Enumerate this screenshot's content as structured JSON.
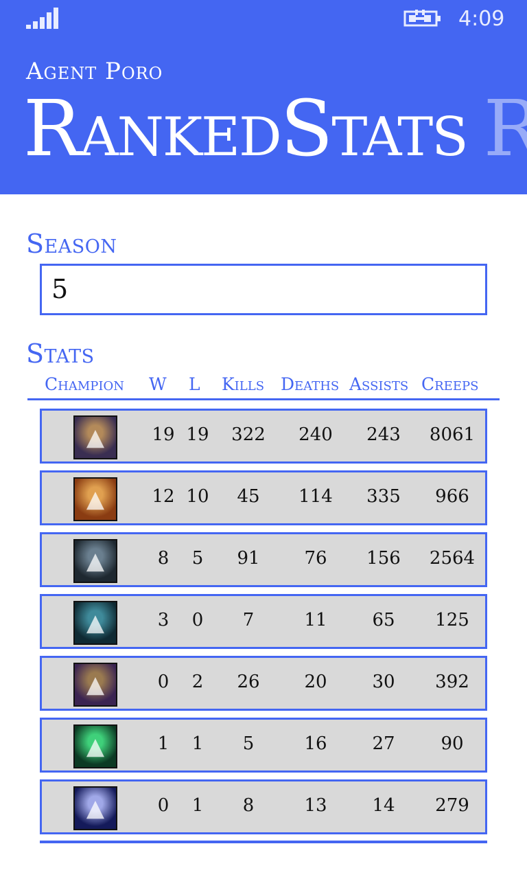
{
  "status_bar": {
    "time": "4:09",
    "signal_icon": "signal-bars-icon",
    "battery_icon": "battery-charging-icon"
  },
  "header": {
    "app_name": "Agent Poro",
    "title": "RankedStats",
    "next_pivot": "R",
    "background_color": "#4466f2"
  },
  "season": {
    "label": "Season",
    "value": "5"
  },
  "stats": {
    "label": "Stats",
    "columns": [
      "Champion",
      "W",
      "L",
      "Kills",
      "Deaths",
      "Assists",
      "Creeps"
    ],
    "rows": [
      {
        "champion_icon": "champion-portrait-1-icon",
        "colors": [
          "#3a2e52",
          "#b38a5a"
        ],
        "w": "19",
        "l": "19",
        "kills": "322",
        "deaths": "240",
        "assists": "243",
        "creeps": "8061"
      },
      {
        "champion_icon": "champion-portrait-2-icon",
        "colors": [
          "#8a3c12",
          "#e0a050"
        ],
        "w": "12",
        "l": "10",
        "kills": "45",
        "deaths": "114",
        "assists": "335",
        "creeps": "966"
      },
      {
        "champion_icon": "champion-portrait-3-icon",
        "colors": [
          "#1e2830",
          "#6a7f8f"
        ],
        "w": "8",
        "l": "5",
        "kills": "91",
        "deaths": "76",
        "assists": "156",
        "creeps": "2564"
      },
      {
        "champion_icon": "champion-portrait-4-icon",
        "colors": [
          "#0f2a33",
          "#3f8a9a"
        ],
        "w": "3",
        "l": "0",
        "kills": "7",
        "deaths": "11",
        "assists": "65",
        "creeps": "125"
      },
      {
        "champion_icon": "champion-portrait-5-icon",
        "colors": [
          "#3b2452",
          "#9a7a50"
        ],
        "w": "0",
        "l": "2",
        "kills": "26",
        "deaths": "20",
        "assists": "30",
        "creeps": "392"
      },
      {
        "champion_icon": "champion-portrait-6-icon",
        "colors": [
          "#0c3a24",
          "#3fd07a"
        ],
        "w": "1",
        "l": "1",
        "kills": "5",
        "deaths": "16",
        "assists": "27",
        "creeps": "90"
      },
      {
        "champion_icon": "champion-portrait-7-icon",
        "colors": [
          "#141a5a",
          "#a0a8e8"
        ],
        "w": "0",
        "l": "1",
        "kills": "8",
        "deaths": "13",
        "assists": "14",
        "creeps": "279"
      }
    ]
  }
}
